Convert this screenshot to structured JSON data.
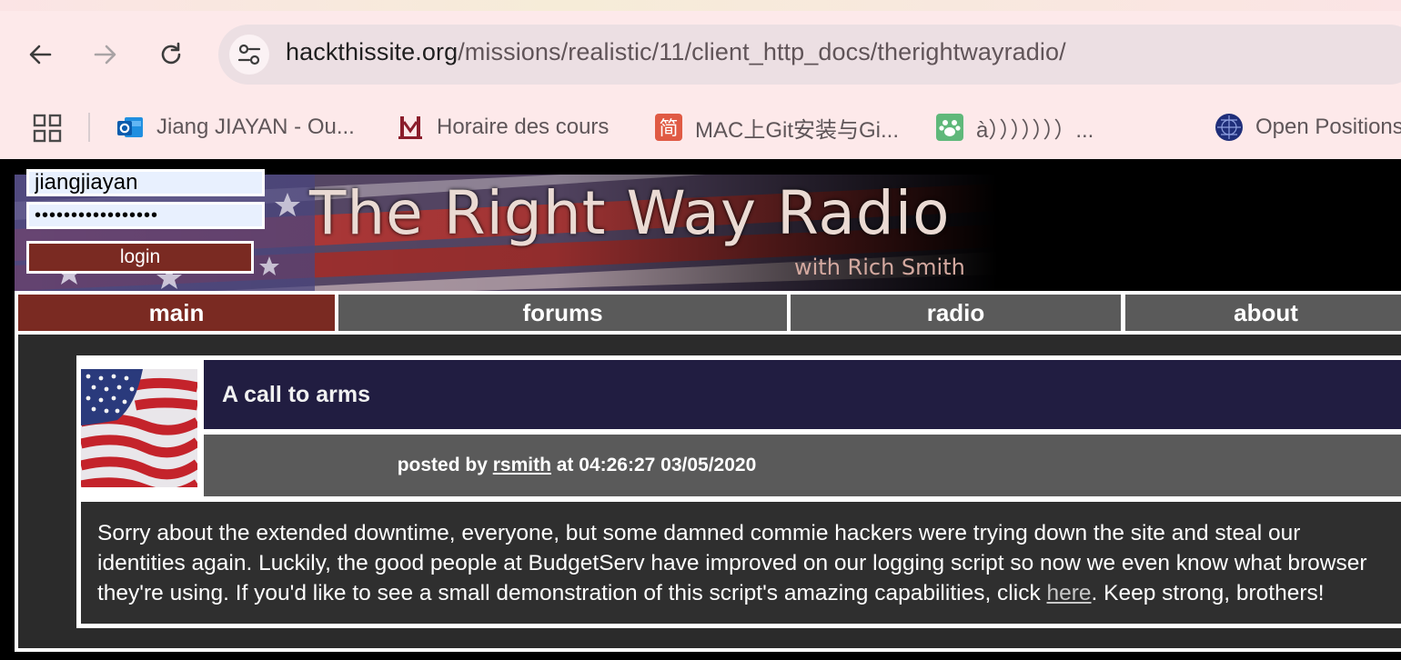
{
  "browser": {
    "url_host": "hackthissite.org",
    "url_path": "/missions/realistic/11/client_http_docs/therightwayradio/",
    "bookmarks": [
      {
        "label": "Jiang JIAYAN - Ou...",
        "icon": "outlook-icon"
      },
      {
        "label": "Horaire des cours",
        "icon": "university-icon"
      },
      {
        "label": "MAC上Git安装与Gi...",
        "icon": "jianshu-icon"
      },
      {
        "label": "à）））））））...",
        "icon": "paw-icon"
      },
      {
        "label": "Open Positions",
        "icon": "globe-grid-icon"
      }
    ]
  },
  "site": {
    "title": "The Right Way Radio",
    "subtitle": "with Rich Smith",
    "login": {
      "username": "jiangjiayan",
      "password": "•••••••••••••••••",
      "button": "login"
    },
    "nav": [
      {
        "label": "main",
        "active": true
      },
      {
        "label": "forums",
        "active": false
      },
      {
        "label": "radio",
        "active": false
      },
      {
        "label": "about",
        "active": false
      }
    ]
  },
  "post": {
    "title": "A call to arms",
    "meta_prefix": "posted by ",
    "author": "rsmith",
    "meta_suffix": " at 04:26:27 03/05/2020",
    "body_line1": "Sorry about the extended downtime, everyone, but some damned commie hackers were trying down the site and steal our",
    "body_line2": "identities again. Luckily, the good people at BudgetServ have improved on our logging script so now we even know what browser",
    "body_line3_before": "they're using. If you'd like to see a small demonstration of this script's amazing capabilities, click ",
    "body_link": "here",
    "body_line3_after": ". Keep strong, brothers!"
  },
  "colors": {
    "nav_active": "#7a2a22",
    "nav_inactive": "#5a5a5a",
    "post_title_bg": "#211d41"
  }
}
